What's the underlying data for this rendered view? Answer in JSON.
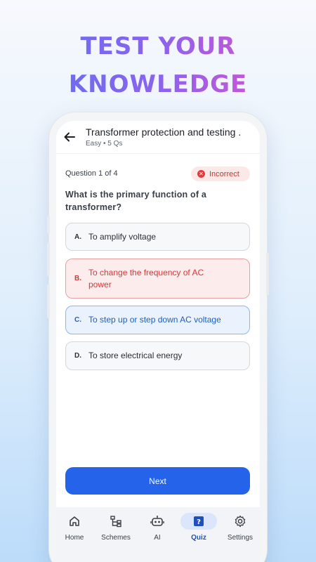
{
  "promo": {
    "line1_a": "TEST ",
    "line1_b": "YOUR",
    "line2": "KNOWLEDGE"
  },
  "appbar": {
    "title": "Transformer protection and testing .",
    "subtitle": "Easy • 5 Qs",
    "back_icon": "arrow-left-icon"
  },
  "quiz": {
    "question_counter": "Question 1 of 4",
    "status_badge": "Incorrect",
    "status_color": "#e23b3b",
    "question": "What is the primary function of a transformer?",
    "options": [
      {
        "letter": "A.",
        "text": "To amplify voltage",
        "state": "neutral"
      },
      {
        "letter": "B.",
        "text": "To change the frequency of AC power",
        "state": "wrong"
      },
      {
        "letter": "C.",
        "text": "To step up or step down AC voltage",
        "state": "correct"
      },
      {
        "letter": "D.",
        "text": "To store electrical energy",
        "state": "neutral"
      }
    ],
    "next_label": "Next",
    "accent_color": "#2563eb"
  },
  "nav": {
    "items": [
      {
        "label": "Home",
        "icon": "home-icon"
      },
      {
        "label": "Schemes",
        "icon": "schemes-icon"
      },
      {
        "label": "AI",
        "icon": "robot-icon"
      },
      {
        "label": "Quiz",
        "icon": "quiz-icon",
        "active": true
      },
      {
        "label": "Settings",
        "icon": "gear-icon"
      }
    ]
  }
}
